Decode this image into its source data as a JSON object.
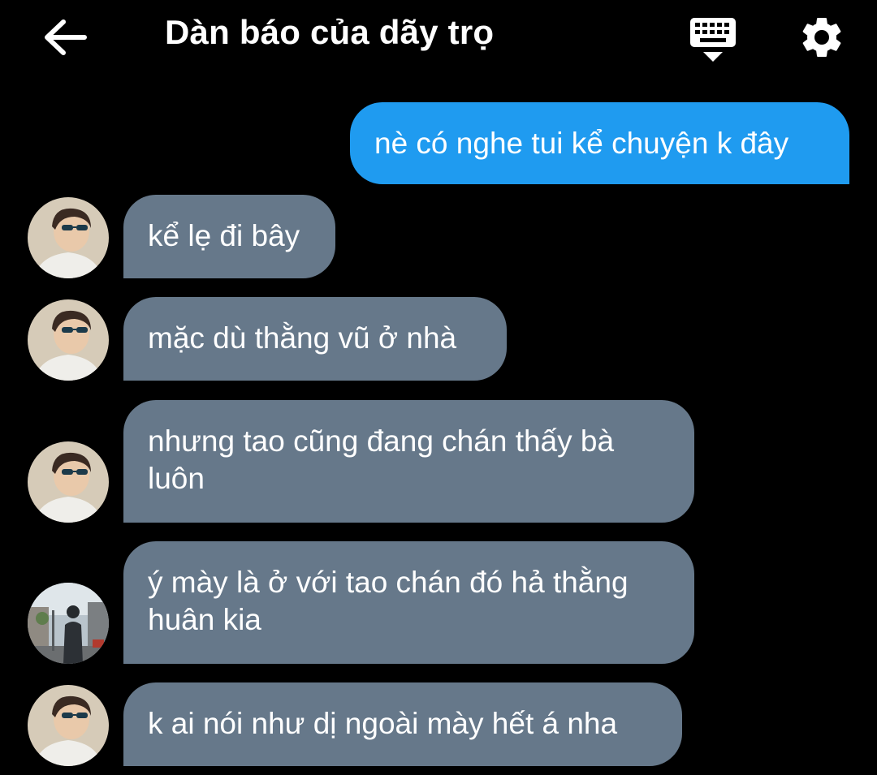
{
  "header": {
    "title": "Dàn báo của dãy trọ",
    "back_icon": "arrow-left-icon",
    "keyboard_icon": "keyboard-icon",
    "settings_icon": "gear-icon"
  },
  "colors": {
    "background": "#000000",
    "outgoing_bubble": "#1f9bf0",
    "incoming_bubble": "#66788a",
    "text": "#ffffff"
  },
  "messages": [
    {
      "direction": "out",
      "text": "nè có nghe tui kể chuyện k đây"
    },
    {
      "direction": "in",
      "avatar": "avatar-sunglasses",
      "text": "kể lẹ đi bây"
    },
    {
      "direction": "in",
      "avatar": "avatar-sunglasses",
      "text": "mặc dù thằng vũ ở nhà"
    },
    {
      "direction": "in",
      "avatar": "avatar-sunglasses",
      "text_line1": "nhưng tao cũng đang chán thấy bà",
      "text_line2": "luôn"
    },
    {
      "direction": "in",
      "avatar": "avatar-street",
      "text_line1": "ý mày là ở với tao chán đó hả thằng",
      "text_line2": "huân kia"
    },
    {
      "direction": "in",
      "avatar": "avatar-sunglasses",
      "text": "k ai nói như dị ngoài mày hết á nha"
    }
  ]
}
